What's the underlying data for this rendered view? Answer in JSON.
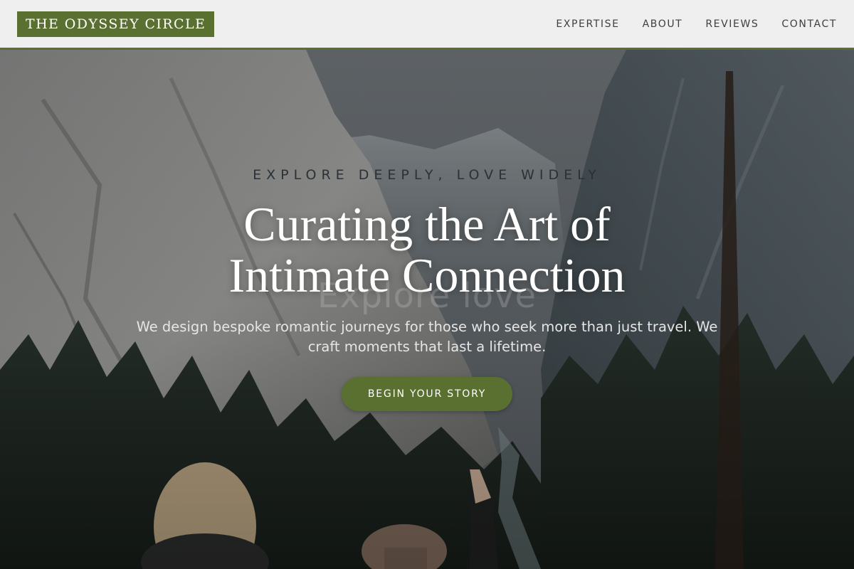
{
  "brand": {
    "name": "THE ODYSSEY CIRCLE",
    "color": "#5a7030"
  },
  "nav": {
    "items": [
      {
        "label": "EXPERTISE"
      },
      {
        "label": "ABOUT"
      },
      {
        "label": "REVIEWS"
      },
      {
        "label": "CONTACT"
      }
    ]
  },
  "hero": {
    "tagline": "EXPLORE DEEPLY, LOVE WIDELY",
    "headline_line1": "Curating the Art of",
    "headline_line2": "Intimate Connection",
    "ghost_text": "Explore love",
    "subtext": "We design bespoke romantic journeys for those who seek more than just travel. We craft moments that last a lifetime.",
    "cta_label": "BEGIN YOUR STORY",
    "background_image": "mountain-valley-with-pine-forest-and-two-travelers"
  },
  "colors": {
    "accent": "#5a7030",
    "header_bg": "#f4f4f4",
    "nav_text": "#3b3f44"
  }
}
